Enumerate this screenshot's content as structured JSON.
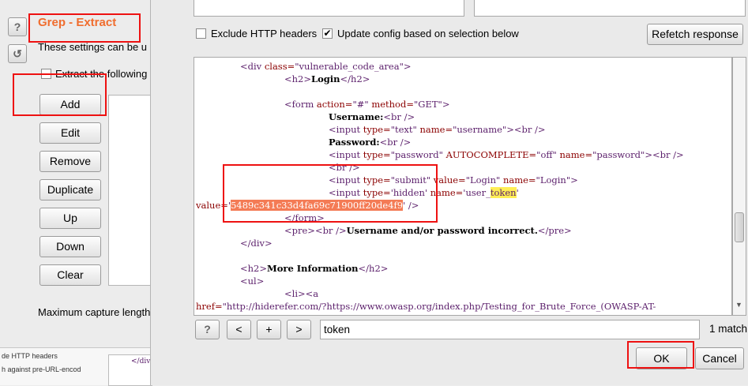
{
  "left_panel": {
    "title": "Grep - Extract",
    "help_glyph": "?",
    "refresh_glyph": "↺",
    "settings_text": "These settings can be u",
    "extract_checkbox_label": "Extract the following",
    "buttons": [
      "Add",
      "Edit",
      "Remove",
      "Duplicate",
      "Up",
      "Down",
      "Clear"
    ],
    "max_capture_label": "Maximum capture length",
    "bottom_lines": [
      "de HTTP headers",
      "h against pre-URL-encod"
    ],
    "bottom_tag": "</div>"
  },
  "options": {
    "exclude_headers_label": "Exclude HTTP headers",
    "exclude_headers_checked": false,
    "update_config_label": "Update config based on selection below",
    "update_config_checked": true,
    "refetch_button": "Refetch response"
  },
  "code": {
    "l1": [
      "<div ",
      "class=",
      "\"vulnerable_code_area\"",
      ">"
    ],
    "l2": [
      "<h2>",
      "Login",
      "</h2>"
    ],
    "l3": [
      "<form ",
      "action=",
      "\"#\" ",
      "method=",
      "\"GET\"",
      ">"
    ],
    "l4": [
      "Username:",
      "<br />"
    ],
    "l5": [
      "<input ",
      "type=",
      "\"text\" ",
      "name=",
      "\"username\"",
      "><br />"
    ],
    "l6": [
      "Password:",
      "<br />"
    ],
    "l7": [
      "<input ",
      "type=",
      "\"password\" ",
      "AUTOCOMPLETE=",
      "\"off\" ",
      "name=",
      "\"password\"",
      "><br />"
    ],
    "l8": [
      "<br />"
    ],
    "l9": [
      "<input ",
      "type=",
      "\"submit\" ",
      "value=",
      "\"Login\" ",
      "name=",
      "\"Login\"",
      ">"
    ],
    "l10": [
      "<input ",
      "type=",
      "'hidden' ",
      "name=",
      "'user_",
      "token",
      "'"
    ],
    "l11": [
      "value=",
      "'",
      "5489c341c33d4fa69c71900ff20de4f9",
      "' />"
    ],
    "l12": [
      "</form>"
    ],
    "l13": [
      "<pre>",
      "<br />",
      "Username and/or password incorrect.",
      "</pre>"
    ],
    "l14": [
      "</div>"
    ],
    "l15": [
      "<h2>",
      "More Information",
      "</h2>"
    ],
    "l16": [
      "<ul>"
    ],
    "l17": [
      "<li>",
      "<a"
    ],
    "l18": [
      "href=",
      "\"http://hiderefer.com/?https://www.owasp.org/index.php/Testing_for_Brute_Force_(OWASP-AT-"
    ]
  },
  "search": {
    "help_glyph": "?",
    "prev_label": "<",
    "add_label": "+",
    "next_label": ">",
    "value": "token",
    "match_count": "1 match"
  },
  "footer": {
    "ok_label": "OK",
    "cancel_label": "Cancel"
  },
  "colors": {
    "title_orange": "#f06d2e",
    "highlight_red": "#e11111",
    "match_yellow": "#ffee55",
    "token_orange": "#f47b55"
  }
}
